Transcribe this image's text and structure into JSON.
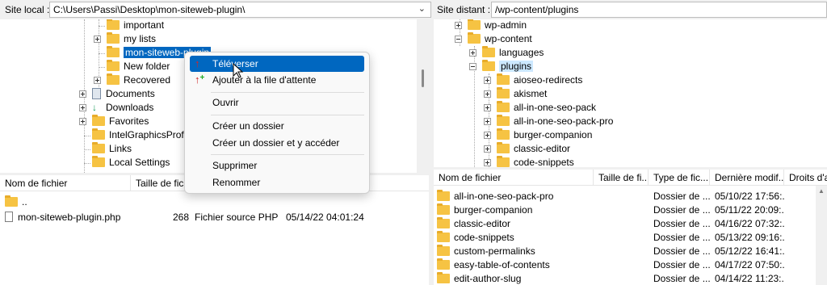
{
  "local": {
    "site_label": "Site local :",
    "path": "C:\\Users\\Passi\\Desktop\\mon-siteweb-plugin\\",
    "tree": [
      "important",
      "my lists",
      "mon-siteweb-plugin",
      "New folder",
      "Recovered",
      "Documents",
      "Downloads",
      "Favorites",
      "IntelGraphicsProfile",
      "Links",
      "Local Settings"
    ],
    "columns": [
      "Nom de fichier",
      "Taille de fic..."
    ],
    "files": [
      {
        "name": "..",
        "size": "",
        "type": "",
        "date": ""
      },
      {
        "name": "mon-siteweb-plugin.php",
        "size": "268",
        "type": "Fichier source PHP",
        "date": "05/14/22 04:01:24"
      }
    ]
  },
  "remote": {
    "site_label": "Site distant :",
    "path": "/wp-content/plugins",
    "tree": [
      "wp-admin",
      "wp-content",
      "languages",
      "plugins",
      "aioseo-redirects",
      "akismet",
      "all-in-one-seo-pack",
      "all-in-one-seo-pack-pro",
      "burger-companion",
      "classic-editor",
      "code-snippets"
    ],
    "columns": [
      "Nom de fichier",
      "Taille de fi...",
      "Type de fic...",
      "Dernière modif...",
      "Droits d'a"
    ],
    "files": [
      {
        "name": "all-in-one-seo-pack-pro",
        "type": "Dossier de ...",
        "date": "05/10/22 17:56:..."
      },
      {
        "name": "burger-companion",
        "type": "Dossier de ...",
        "date": "05/11/22 20:09:..."
      },
      {
        "name": "classic-editor",
        "type": "Dossier de ...",
        "date": "04/16/22 07:32:..."
      },
      {
        "name": "code-snippets",
        "type": "Dossier de ...",
        "date": "05/13/22 09:16:..."
      },
      {
        "name": "custom-permalinks",
        "type": "Dossier de ...",
        "date": "05/12/22 16:41:..."
      },
      {
        "name": "easy-table-of-contents",
        "type": "Dossier de ...",
        "date": "04/17/22 07:50:..."
      },
      {
        "name": "edit-author-slug",
        "type": "Dossier de ...",
        "date": "04/14/22 11:23:..."
      }
    ]
  },
  "context_menu": {
    "items": [
      "Téléverser",
      "Ajouter à la file d'attente",
      "Ouvrir",
      "Créer un dossier",
      "Créer un dossier et y accéder",
      "Supprimer",
      "Renommer"
    ]
  },
  "colors": {
    "accent": "#0067c0",
    "folder": "#f6c343",
    "selection": "#cce8ff"
  }
}
